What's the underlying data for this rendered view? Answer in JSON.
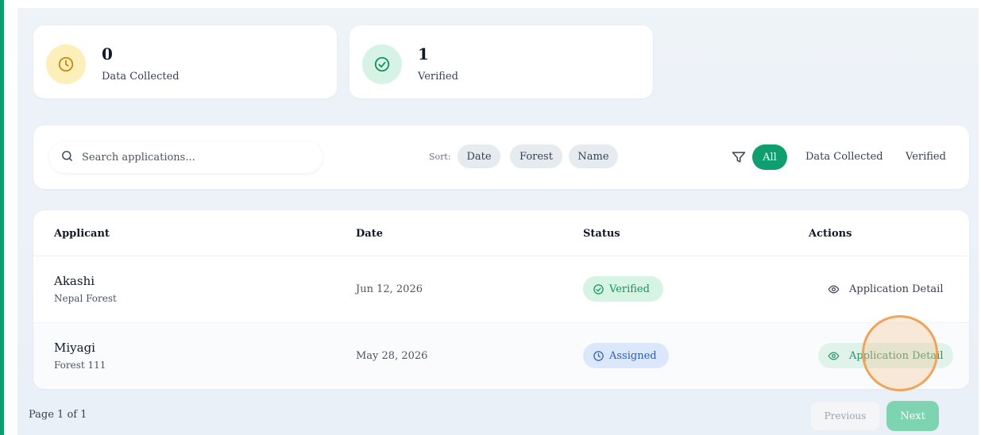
{
  "stats": [
    {
      "value": "0",
      "label": "Data Collected",
      "icon": "clock-icon",
      "bg": "#fdefb9",
      "color": "#c98a0c"
    },
    {
      "value": "1",
      "label": "Verified",
      "icon": "check-circle-icon",
      "bg": "#d7f3e5",
      "color": "#15935f"
    }
  ],
  "toolbar": {
    "search_placeholder": "Search applications...",
    "sort_label": "Sort:",
    "sort_options": [
      "Date",
      "Forest",
      "Name"
    ],
    "filters": [
      "All",
      "Data Collected",
      "Verified"
    ],
    "active_filter": "All"
  },
  "table": {
    "headers": [
      "Applicant",
      "Date",
      "Status",
      "Actions"
    ],
    "rows": [
      {
        "name": "Akashi",
        "forest": "Nepal Forest",
        "date": "Jun 12, 2026",
        "status": "Verified",
        "action": "Application Detail"
      },
      {
        "name": "Miyagi",
        "forest": "Forest 111",
        "date": "May 28, 2026",
        "status": "Assigned",
        "action": "Application Detail"
      }
    ]
  },
  "pagination": {
    "info": "Page 1 of 1",
    "prev": "Previous",
    "next": "Next"
  },
  "colors": {
    "accent": "#0f9f6e",
    "verified_bg": "#d6f4e3",
    "assigned_bg": "#dbe7fb"
  }
}
